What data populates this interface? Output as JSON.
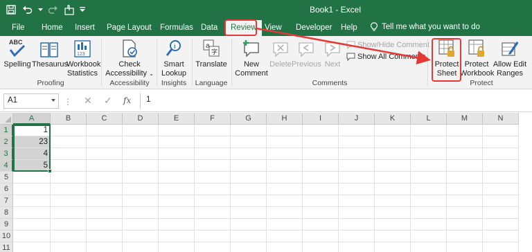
{
  "titlebar": {
    "title": "Book1  -  Excel",
    "qat": [
      "save-icon",
      "undo-icon",
      "redo-icon",
      "touch-mode-icon",
      "customize-qat-icon"
    ]
  },
  "tabs": [
    "File",
    "Home",
    "Insert",
    "Page Layout",
    "Formulas",
    "Data",
    "Review",
    "View",
    "Developer",
    "Help"
  ],
  "active_tab": "Review",
  "tell_me": "Tell me what you want to do",
  "ribbon": {
    "proofing": {
      "label": "Proofing",
      "spelling": "Spelling",
      "thesaurus": "Thesaurus",
      "workbook_statistics": [
        "Workbook",
        "Statistics"
      ]
    },
    "accessibility": {
      "label": "Accessibility",
      "check": [
        "Check",
        "Accessibility"
      ]
    },
    "insights": {
      "label": "Insights",
      "smart_lookup": [
        "Smart",
        "Lookup"
      ]
    },
    "language": {
      "label": "Language",
      "translate": "Translate"
    },
    "comments": {
      "label": "Comments",
      "new_comment": [
        "New",
        "Comment"
      ],
      "delete": "Delete",
      "previous": "Previous",
      "next": "Next",
      "show_hide": "Show/Hide Comment",
      "show_all": "Show All Comments"
    },
    "protect": {
      "label": "Protect",
      "protect_sheet": [
        "Protect",
        "Sheet"
      ],
      "protect_workbook": [
        "Protect",
        "Workbook"
      ],
      "allow_edit_ranges": [
        "Allow Edit",
        "Ranges"
      ]
    }
  },
  "formula_bar": {
    "name_box": "A1",
    "cancel_icon": "✕",
    "enter_icon": "✓",
    "fx_label": "fx",
    "value": "1"
  },
  "grid": {
    "columns": [
      "A",
      "B",
      "C",
      "D",
      "E",
      "F",
      "G",
      "H",
      "I",
      "J",
      "K",
      "L",
      "M",
      "N"
    ],
    "rows": [
      "1",
      "2",
      "3",
      "4",
      "5",
      "6",
      "7",
      "8",
      "9",
      "10",
      "11"
    ],
    "cells_A": [
      "1",
      "23",
      "4",
      "5"
    ],
    "selected_range": "A1:A4"
  },
  "colors": {
    "excel_green": "#217346",
    "annotation_red": "#e53935"
  }
}
